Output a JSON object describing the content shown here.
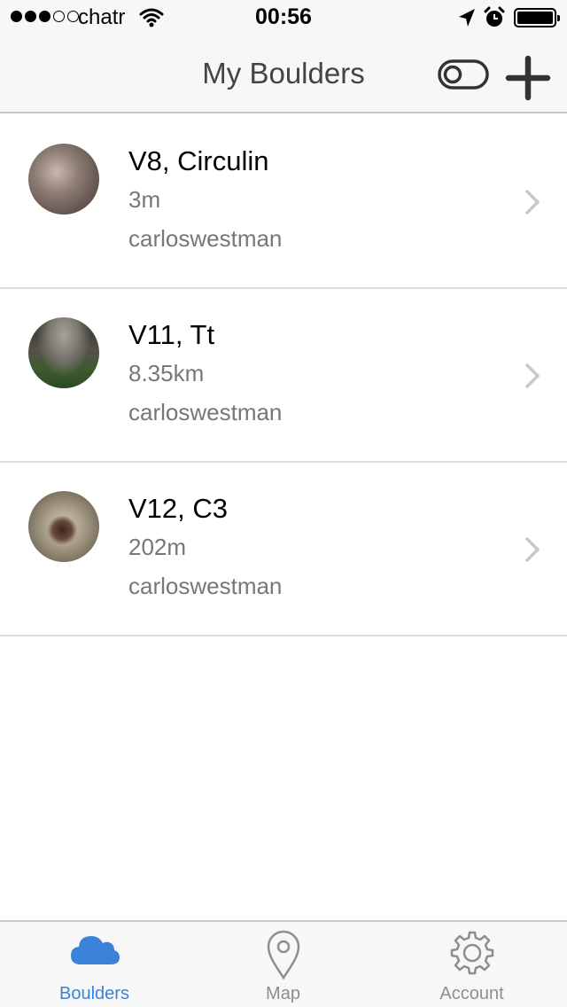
{
  "status_bar": {
    "carrier": "chatr",
    "time": "00:56",
    "signal_filled": 3,
    "signal_total": 5
  },
  "nav": {
    "title": "My Boulders",
    "toggle_icon": "toggle-icon",
    "add_icon": "plus-icon"
  },
  "boulders": [
    {
      "title": "V8, Circulin",
      "distance": "3m",
      "user": "carloswestman"
    },
    {
      "title": "V11, Tt",
      "distance": "8.35km",
      "user": "carloswestman"
    },
    {
      "title": "V12, C3",
      "distance": "202m",
      "user": "carloswestman"
    }
  ],
  "tabs": [
    {
      "label": "Boulders",
      "icon": "cloud-icon",
      "active": true
    },
    {
      "label": "Map",
      "icon": "map-pin-icon",
      "active": false
    },
    {
      "label": "Account",
      "icon": "gear-icon",
      "active": false
    }
  ],
  "colors": {
    "accent": "#3b82d9",
    "bar_background": "#f7f7f7",
    "secondary_text": "#777777"
  }
}
